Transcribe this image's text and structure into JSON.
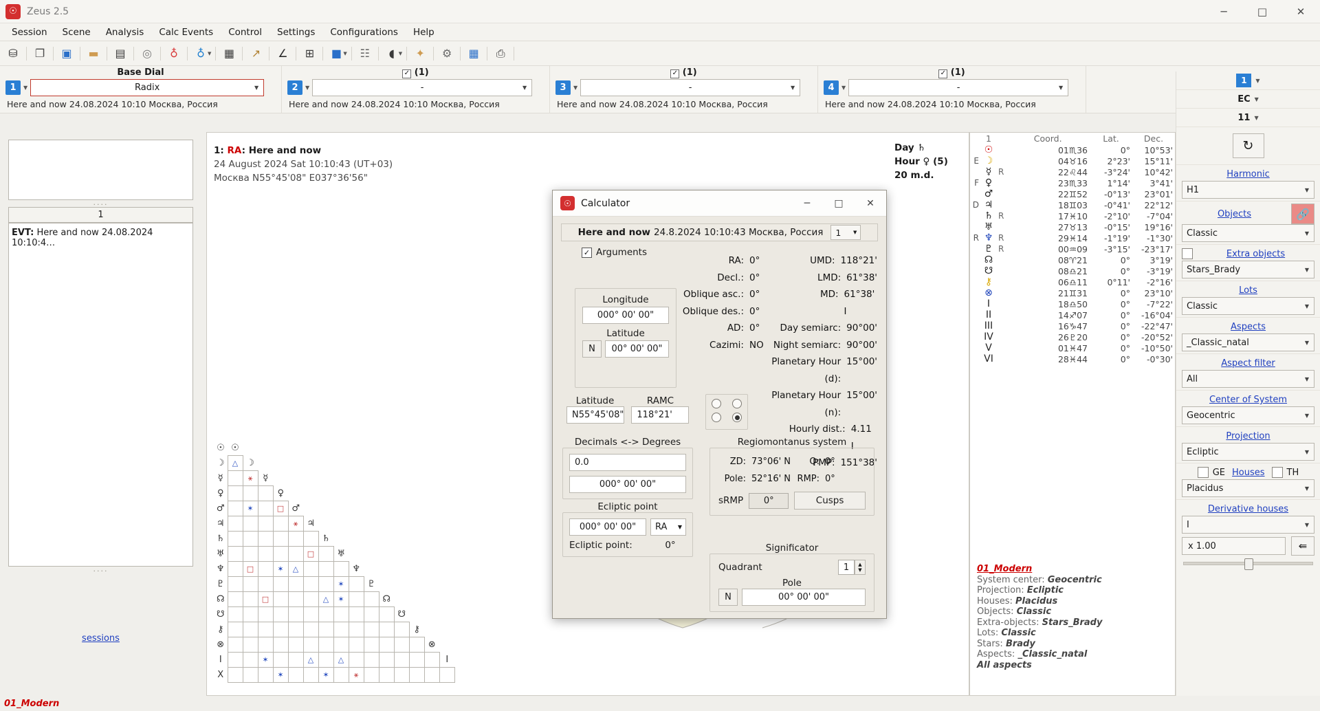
{
  "app": {
    "title": "Zeus  2.5",
    "icon": "zeus-logo-icon",
    "window_controls": {
      "minimize": "─",
      "maximize": "□",
      "close": "✕"
    }
  },
  "menu": {
    "items": [
      "Session",
      "Scene",
      "Analysis",
      "Calc Events",
      "Control",
      "Settings",
      "Configurations",
      "Help"
    ]
  },
  "toolbar": {
    "buttons": [
      {
        "name": "database-icon",
        "glyph": "⛁",
        "color": "#2b2b2b",
        "caret": false
      },
      {
        "name": "new-document-icon",
        "glyph": "❐",
        "color": "#4a4a4a",
        "caret": false
      },
      {
        "name": "save-icon",
        "glyph": "▣",
        "color": "#2a6fc9",
        "caret": false
      },
      {
        "name": "briefcase-icon",
        "glyph": "▬",
        "color": "#cf9c52",
        "caret": false
      },
      {
        "name": "notebook-icon",
        "glyph": "▤",
        "color": "#3a3a3a",
        "caret": false
      },
      {
        "name": "target-dial-icon",
        "glyph": "◎",
        "color": "#7b7b7b",
        "caret": false
      },
      {
        "name": "red-globe-icon",
        "glyph": "♁",
        "color": "#d83a3a",
        "caret": false
      },
      {
        "name": "blue-globe-icon",
        "glyph": "♁",
        "color": "#1f7fd0",
        "caret": true
      },
      {
        "name": "calculator-icon",
        "glyph": "▦",
        "color": "#3a3a3a",
        "caret": false
      },
      {
        "name": "chart-line-icon",
        "glyph": "↗",
        "color": "#b08030",
        "caret": false
      },
      {
        "name": "angle-icon",
        "glyph": "∠",
        "color": "#2b2b2b",
        "caret": false
      },
      {
        "name": "table-grid-icon",
        "glyph": "⊞",
        "color": "#3a3a3a",
        "caret": false
      },
      {
        "name": "colors-icon",
        "glyph": "■",
        "color": "#2a6fc9",
        "caret": true
      },
      {
        "name": "ephemeris-icon",
        "glyph": "☷",
        "color": "#6a6a6a",
        "caret": false
      },
      {
        "name": "moon-phase-icon",
        "glyph": "◖",
        "color": "#3a3a3a",
        "caret": true
      },
      {
        "name": "star-map-icon",
        "glyph": "✦",
        "color": "#cf9c52",
        "caret": false
      },
      {
        "name": "gear-settings-icon",
        "glyph": "⚙",
        "color": "#6a6a6a",
        "caret": false
      },
      {
        "name": "grid-table-icon",
        "glyph": "▦",
        "color": "#2a6fc9",
        "caret": false
      },
      {
        "name": "print-icon",
        "glyph": "⎙",
        "color": "#3a3a3a",
        "caret": false
      }
    ]
  },
  "dials": {
    "header": "Base Dial",
    "items": [
      {
        "num": "1",
        "value": "Radix",
        "selected": true,
        "checkbox": null,
        "sub": "Here and now 24.08.2024 10:10 Москва, Россия"
      },
      {
        "num": "2",
        "value": "-",
        "selected": false,
        "checkbox": "(1)",
        "sub": "Here and now 24.08.2024 10:10 Москва, Россия"
      },
      {
        "num": "3",
        "value": "-",
        "selected": false,
        "checkbox": "(1)",
        "sub": "Here and now 24.08.2024 10:10 Москва, Россия"
      },
      {
        "num": "4",
        "value": "-",
        "selected": false,
        "checkbox": "(1)",
        "sub": "Here and now 24.08.2024 10:10 Москва, Россия"
      }
    ]
  },
  "left_panel": {
    "list_header": "1",
    "event_label": "EVT:",
    "event_text": "Here and now 24.08.2024 10:10:4…",
    "sessions_link": "sessions"
  },
  "canvas": {
    "chart_title_num": "1:",
    "chart_title_ra": "RA",
    "chart_title_rest": ": Here and now",
    "chart_line2": "24 August 2024 Sat 10:10:43 (UT+03)",
    "chart_line3": "Москва N55°45'08\" E037°36'56\"",
    "day_line1": "Day ♄",
    "day_line2": "Hour ♀ (5)",
    "day_line3": "20 m.d."
  },
  "table": {
    "col_num": "1",
    "headers": [
      "Coord.",
      "Lat.",
      "Dec."
    ],
    "rows": [
      {
        "pre": "",
        "glyph": "☉",
        "cls": "sun",
        "r": "",
        "coord": "01♏36",
        "lat": "0°",
        "dec": "10°53'"
      },
      {
        "pre": "E",
        "glyph": "☽",
        "cls": "moon",
        "r": "",
        "coord": "04♉16",
        "lat": "2°23'",
        "dec": "15°11'"
      },
      {
        "pre": "",
        "glyph": "☿",
        "cls": "merc",
        "r": "R",
        "coord": "22♌44",
        "lat": "-3°24'",
        "dec": "10°42'"
      },
      {
        "pre": "F",
        "glyph": "♀",
        "cls": "merc",
        "r": "",
        "coord": "23♏33",
        "lat": "1°14'",
        "dec": "3°41'"
      },
      {
        "pre": "",
        "glyph": "♂",
        "cls": "merc",
        "r": "",
        "coord": "22♊52",
        "lat": "-0°13'",
        "dec": "23°01'"
      },
      {
        "pre": "D",
        "glyph": "♃",
        "cls": "merc",
        "r": "",
        "coord": "18♊03",
        "lat": "-0°41'",
        "dec": "22°12'"
      },
      {
        "pre": "",
        "glyph": "♄",
        "cls": "merc",
        "r": "R",
        "coord": "17♓10",
        "lat": "-2°10'",
        "dec": "-7°04'"
      },
      {
        "pre": "",
        "glyph": "♅",
        "cls": "merc",
        "r": "",
        "coord": "27♉13",
        "lat": "-0°15'",
        "dec": "19°16'"
      },
      {
        "pre": "R",
        "glyph": "♆",
        "cls": "blue",
        "r": "R",
        "coord": "29♓14",
        "lat": "-1°19'",
        "dec": "-1°30'"
      },
      {
        "pre": "",
        "glyph": "♇",
        "cls": "merc",
        "r": "R",
        "coord": "00♒09",
        "lat": "-3°15'",
        "dec": "-23°17'"
      },
      {
        "pre": "",
        "glyph": "☊",
        "cls": "merc",
        "r": "",
        "coord": "08♈21",
        "lat": "0°",
        "dec": "3°19'"
      },
      {
        "pre": "",
        "glyph": "☋",
        "cls": "merc",
        "r": "",
        "coord": "08♎21",
        "lat": "0°",
        "dec": "-3°19'"
      },
      {
        "pre": "",
        "glyph": "⚷",
        "cls": "moon",
        "r": "",
        "coord": "06♎11",
        "lat": "0°11'",
        "dec": "-2°16'"
      },
      {
        "pre": "",
        "glyph": "⊗",
        "cls": "blue",
        "r": "",
        "coord": "21♊31",
        "lat": "0°",
        "dec": "23°10'"
      },
      {
        "pre": "",
        "glyph": "I",
        "cls": "merc",
        "r": "",
        "coord": "18♎50",
        "lat": "0°",
        "dec": "-7°22'"
      },
      {
        "pre": "",
        "glyph": "II",
        "cls": "merc",
        "r": "",
        "coord": "14♐07",
        "lat": "0°",
        "dec": "-16°04'"
      },
      {
        "pre": "",
        "glyph": "III",
        "cls": "merc",
        "r": "",
        "coord": "16♑47",
        "lat": "0°",
        "dec": "-22°47'"
      },
      {
        "pre": "",
        "glyph": "IV",
        "cls": "merc",
        "r": "",
        "coord": "26♇20",
        "lat": "0°",
        "dec": "-20°52'"
      },
      {
        "pre": "",
        "glyph": "V",
        "cls": "merc",
        "r": "",
        "coord": "01♓47",
        "lat": "0°",
        "dec": "-10°50'"
      },
      {
        "pre": "",
        "glyph": "VI",
        "cls": "merc",
        "r": "",
        "coord": "28♓44",
        "lat": "0°",
        "dec": "-0°30'"
      }
    ]
  },
  "info_block": {
    "title": "01_Modern",
    "lines": [
      {
        "k": "System center: ",
        "v": "Geocentric"
      },
      {
        "k": "Projection: ",
        "v": "Ecliptic"
      },
      {
        "k": "Houses: ",
        "v": "Placidus"
      },
      {
        "k": "Objects: ",
        "v": "Classic"
      },
      {
        "k": "Extra-objects: ",
        "v": "Stars_Brady"
      },
      {
        "k": "Lots: ",
        "v": "Classic"
      },
      {
        "k": "Stars: ",
        "v": "Brady"
      },
      {
        "k": "Aspects: ",
        "v": "_Classic_natal"
      }
    ],
    "footer": "All aspects"
  },
  "sidebar": {
    "top_num": "1",
    "ec_label": "EC",
    "eleven_label": "11",
    "refresh_icon": "refresh-icon",
    "harmonic_label": "Harmonic",
    "harmonic_value": "H1",
    "objects_label": "Objects",
    "objects_value": "Classic",
    "link_icon": "link-chain-icon",
    "extra_objects_label": "Extra objects",
    "extra_objects_value": "Stars_Brady",
    "lots_label": "Lots",
    "lots_value": "Classic",
    "aspects_label": "Aspects",
    "aspects_value": "_Classic_natal",
    "aspect_filter_label": "Aspect filter",
    "aspect_filter_value": "All",
    "center_label": "Center of System",
    "center_value": "Geocentric",
    "projection_label": "Projection",
    "projection_value": "Ecliptic",
    "ge_label": "GE",
    "houses_label": "Houses",
    "th_label": "TH",
    "houses_value": "Placidus",
    "derivative_label": "Derivative houses",
    "derivative_value": "I",
    "zoom_value": "x 1.00",
    "undo_icon": "undo-arrow-icon"
  },
  "statusbar": {
    "text": "01_Modern"
  },
  "calculator": {
    "title": "Calculator",
    "icon": "zeus-logo-icon",
    "window_controls": {
      "minimize": "─",
      "maximize": "□",
      "close": "✕"
    },
    "header_bold": "Here and now",
    "header_rest": "24.8.2024 10:10:43 Москва, Россия",
    "header_select": "1",
    "arguments_label": "Arguments",
    "arguments_checked": true,
    "longitude_label": "Longitude",
    "longitude_value": "000° 00' 00\"",
    "latitude_label": "Latitude",
    "latitude_hemisphere": "N",
    "latitude_value": "00° 00' 00\"",
    "left_col": [
      {
        "k": "RA:",
        "v": "0°"
      },
      {
        "k": "Decl.:",
        "v": "0°"
      },
      {
        "k": "Oblique asc.:",
        "v": "0°"
      },
      {
        "k": "Oblique des.:",
        "v": "0°"
      },
      {
        "k": "AD:",
        "v": "0°"
      },
      {
        "k": "Cazimi:",
        "v": "NO"
      }
    ],
    "right_col": [
      {
        "k": "UMD:",
        "v": "118°21'"
      },
      {
        "k": "LMD:",
        "v": "61°38'"
      },
      {
        "k": "MD:",
        "v": "61°38' I"
      },
      {
        "k": "Day semiarc:",
        "v": "90°00'"
      },
      {
        "k": "Night semiarc:",
        "v": "90°00'"
      },
      {
        "k": "Planetary  Hour (d):",
        "v": "15°00'"
      },
      {
        "k": "Planetary  Hour (n):",
        "v": "15°00'"
      },
      {
        "k": "Hourly dist.:",
        "v": "4.11 I"
      },
      {
        "k": "PMP:",
        "v": "151°38'"
      }
    ],
    "latitude2_label": "Latitude",
    "latitude2_value": "N55°45'08\"",
    "ramc_label": "RAMC",
    "ramc_value": "118°21'",
    "decimals_label": "Decimals <-> Degrees",
    "decimals_value": "0.0",
    "degrees_value": "000° 00' 00\"",
    "ecliptic_group_label": "Ecliptic point",
    "ecliptic_value": "000° 00' 00\"",
    "ecliptic_mode": "RA",
    "ecliptic_point_label": "Ecliptic point:",
    "ecliptic_point_value": "0°",
    "regio_title": "Regiomontanus system",
    "regio": [
      {
        "k": "ZD:",
        "v": "73°06' N"
      },
      {
        "k": "Pole:",
        "v": "52°16' N"
      }
    ],
    "regio_right": [
      {
        "k": "Q:",
        "v": "0°"
      },
      {
        "k": "RMP:",
        "v": "0°"
      }
    ],
    "srmp_label": "sRMP",
    "srmp_value": "0°",
    "cusps_button": "Cusps",
    "significator_title": "Significator",
    "quadrant_label": "Quadrant",
    "quadrant_value": "1",
    "pole_label": "Pole",
    "pole_hemisphere": "N",
    "pole_value": "00° 00' 00\""
  },
  "aspect_grid": {
    "row_labels": [
      "☉",
      "☽",
      "☿",
      "♀",
      "♂",
      "♃",
      "♄",
      "♅",
      "♆",
      "♇",
      "☊",
      "☋",
      "⚷",
      "⊗",
      "I",
      "X"
    ],
    "col_labels": [
      "☽",
      "☿",
      "♀",
      "♂",
      "♃",
      "♄",
      "♅",
      "♆",
      "♇",
      "☊",
      "☋",
      "⚷",
      "⊗",
      "I",
      "X"
    ],
    "cells": [
      {
        "r": 1,
        "c": 0,
        "glyph": "△",
        "color": "#2a4fc0"
      },
      {
        "r": 2,
        "c": 1,
        "glyph": "⚹",
        "color": "#c23a3a"
      },
      {
        "r": 4,
        "c": 1,
        "glyph": "✶",
        "color": "#2a4fc0"
      },
      {
        "r": 4,
        "c": 3,
        "glyph": "□",
        "color": "#c23a3a"
      },
      {
        "r": 5,
        "c": 4,
        "glyph": "⚹",
        "color": "#c23a3a"
      },
      {
        "r": 7,
        "c": 5,
        "glyph": "□",
        "color": "#c23a3a"
      },
      {
        "r": 8,
        "c": 1,
        "glyph": "□",
        "color": "#c23a3a"
      },
      {
        "r": 8,
        "c": 3,
        "glyph": "✶",
        "color": "#2a4fc0"
      },
      {
        "r": 8,
        "c": 4,
        "glyph": "△",
        "color": "#2a4fc0"
      },
      {
        "r": 9,
        "c": 7,
        "glyph": "✶",
        "color": "#2a4fc0"
      },
      {
        "r": 10,
        "c": 2,
        "glyph": "□",
        "color": "#c23a3a"
      },
      {
        "r": 10,
        "c": 6,
        "glyph": "△",
        "color": "#2a4fc0"
      },
      {
        "r": 10,
        "c": 7,
        "glyph": "✶",
        "color": "#2a4fc0"
      },
      {
        "r": 14,
        "c": 2,
        "glyph": "✶",
        "color": "#2a4fc0"
      },
      {
        "r": 14,
        "c": 5,
        "glyph": "△",
        "color": "#2a4fc0"
      },
      {
        "r": 14,
        "c": 7,
        "glyph": "△",
        "color": "#2a4fc0"
      },
      {
        "r": 15,
        "c": 3,
        "glyph": "✶",
        "color": "#2a4fc0"
      },
      {
        "r": 15,
        "c": 6,
        "glyph": "✶",
        "color": "#2a4fc0"
      },
      {
        "r": 15,
        "c": 8,
        "glyph": "⚹",
        "color": "#c23a3a"
      }
    ]
  }
}
